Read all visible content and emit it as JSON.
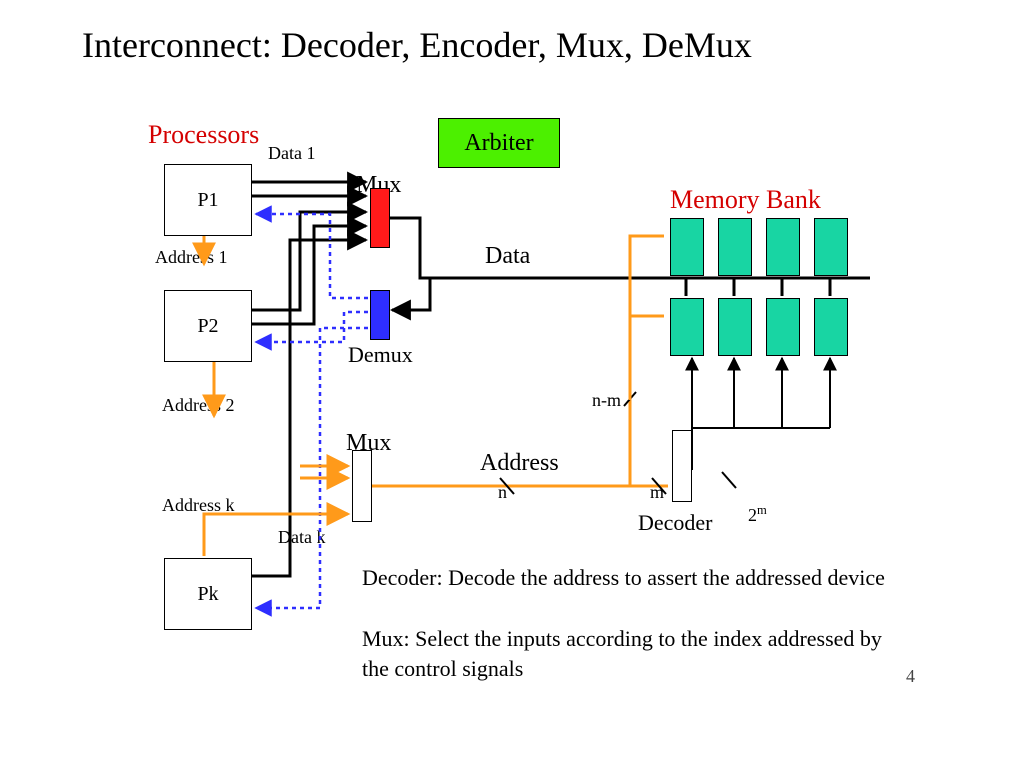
{
  "title": "Interconnect: Decoder, Encoder, Mux, DeMux",
  "labels": {
    "processors": "Processors",
    "memory_bank": "Memory Bank",
    "arbiter": "Arbiter",
    "p1": "P1",
    "p2": "P2",
    "pk": "Pk",
    "data1": "Data 1",
    "datak": "Data k",
    "address1": "Address 1",
    "address2": "Address 2",
    "addressk": "Address k",
    "mux_top": "Mux",
    "demux": "Demux",
    "mux_addr": "Mux",
    "data_bus": "Data",
    "address_bus": "Address",
    "n": "n",
    "nm": "n-m",
    "m": "m",
    "two_m": "2",
    "two_m_sup": "m",
    "decoder": "Decoder"
  },
  "caption_line1": "Decoder: Decode the address to assert the addressed device",
  "caption_line2": "Mux: Select the inputs according to the index addressed by the control signals",
  "slide_number": "4",
  "colors": {
    "accent_red": "#d40000",
    "arbiter_fill": "#4cf000",
    "mux_fill": "#ff1a1a",
    "demux_fill": "#2e2eff",
    "mem_fill": "#18d5a3",
    "orange": "#ff9a1a",
    "blue_dotted": "#2e2eff"
  },
  "memory": {
    "rows": 2,
    "cols": 4
  }
}
